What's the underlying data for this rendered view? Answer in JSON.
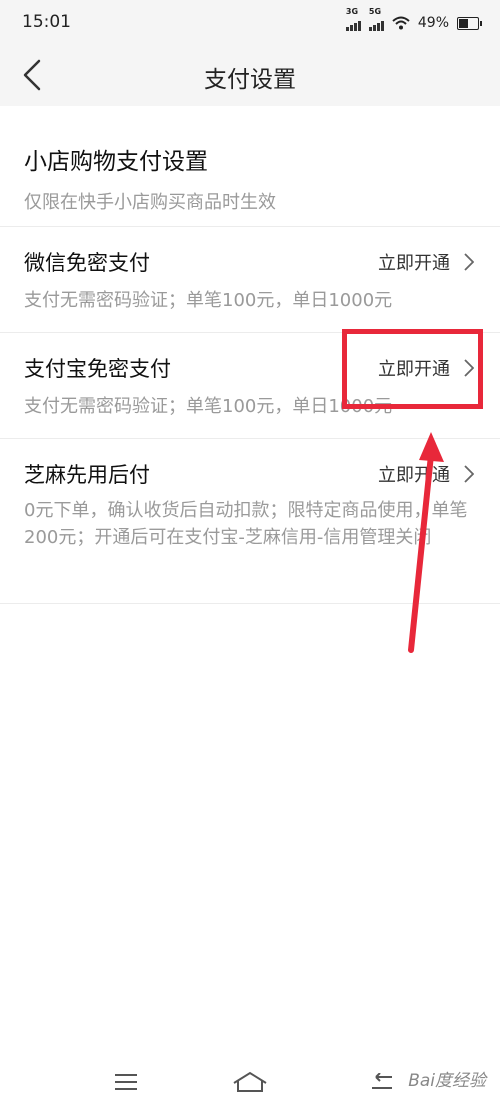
{
  "status_bar": {
    "time": "15:01",
    "network_1": "3G",
    "network_2": "5G",
    "battery": "49%"
  },
  "header": {
    "title": "支付设置"
  },
  "section": {
    "title": "小店购物支付设置",
    "subtitle": "仅限在快手小店购买商品时生效"
  },
  "rows": [
    {
      "title": "微信免密支付",
      "action": "立即开通",
      "description": "支付无需密码验证；单笔100元，单日1000元"
    },
    {
      "title": "支付宝免密支付",
      "action": "立即开通",
      "description": "支付无需密码验证；单笔100元，单日1000元"
    },
    {
      "title": "芝麻先用后付",
      "action": "立即开通",
      "description": "0元下单，确认收货后自动扣款；限特定商品使用，单笔200元；开通后可在支付宝-芝麻信用-信用管理关闭"
    }
  ],
  "annotation": {
    "highlight_color": "#e8283a"
  },
  "watermark": "Bai度经验"
}
